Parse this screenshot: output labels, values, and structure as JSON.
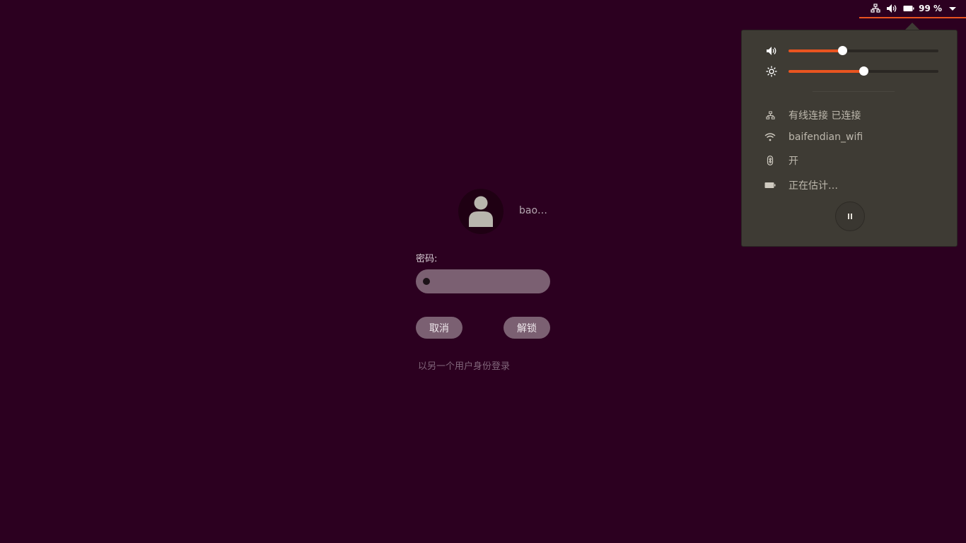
{
  "topbar": {
    "icons": [
      "network-wired-icon",
      "volume-icon",
      "battery-icon"
    ],
    "battery_percent": "99 %",
    "accent": "#e95420"
  },
  "menu": {
    "volume": {
      "icon": "volume-icon",
      "level": 0.36
    },
    "brightness": {
      "icon": "brightness-icon",
      "level": 0.5
    },
    "items": [
      {
        "icon": "network-wired-icon",
        "label": "有线连接 已连接"
      },
      {
        "icon": "wifi-icon",
        "label": "baifendian_wifi"
      },
      {
        "icon": "bluetooth-icon",
        "label": "开"
      },
      {
        "icon": "battery-icon",
        "label": "正在估计…"
      }
    ],
    "pause_icon": "pause-icon"
  },
  "lock": {
    "username": "bao…",
    "password_label": "密码:",
    "cancel_label": "取消",
    "unlock_label": "解锁",
    "other_user_link": "以另一个用户身份登录"
  }
}
